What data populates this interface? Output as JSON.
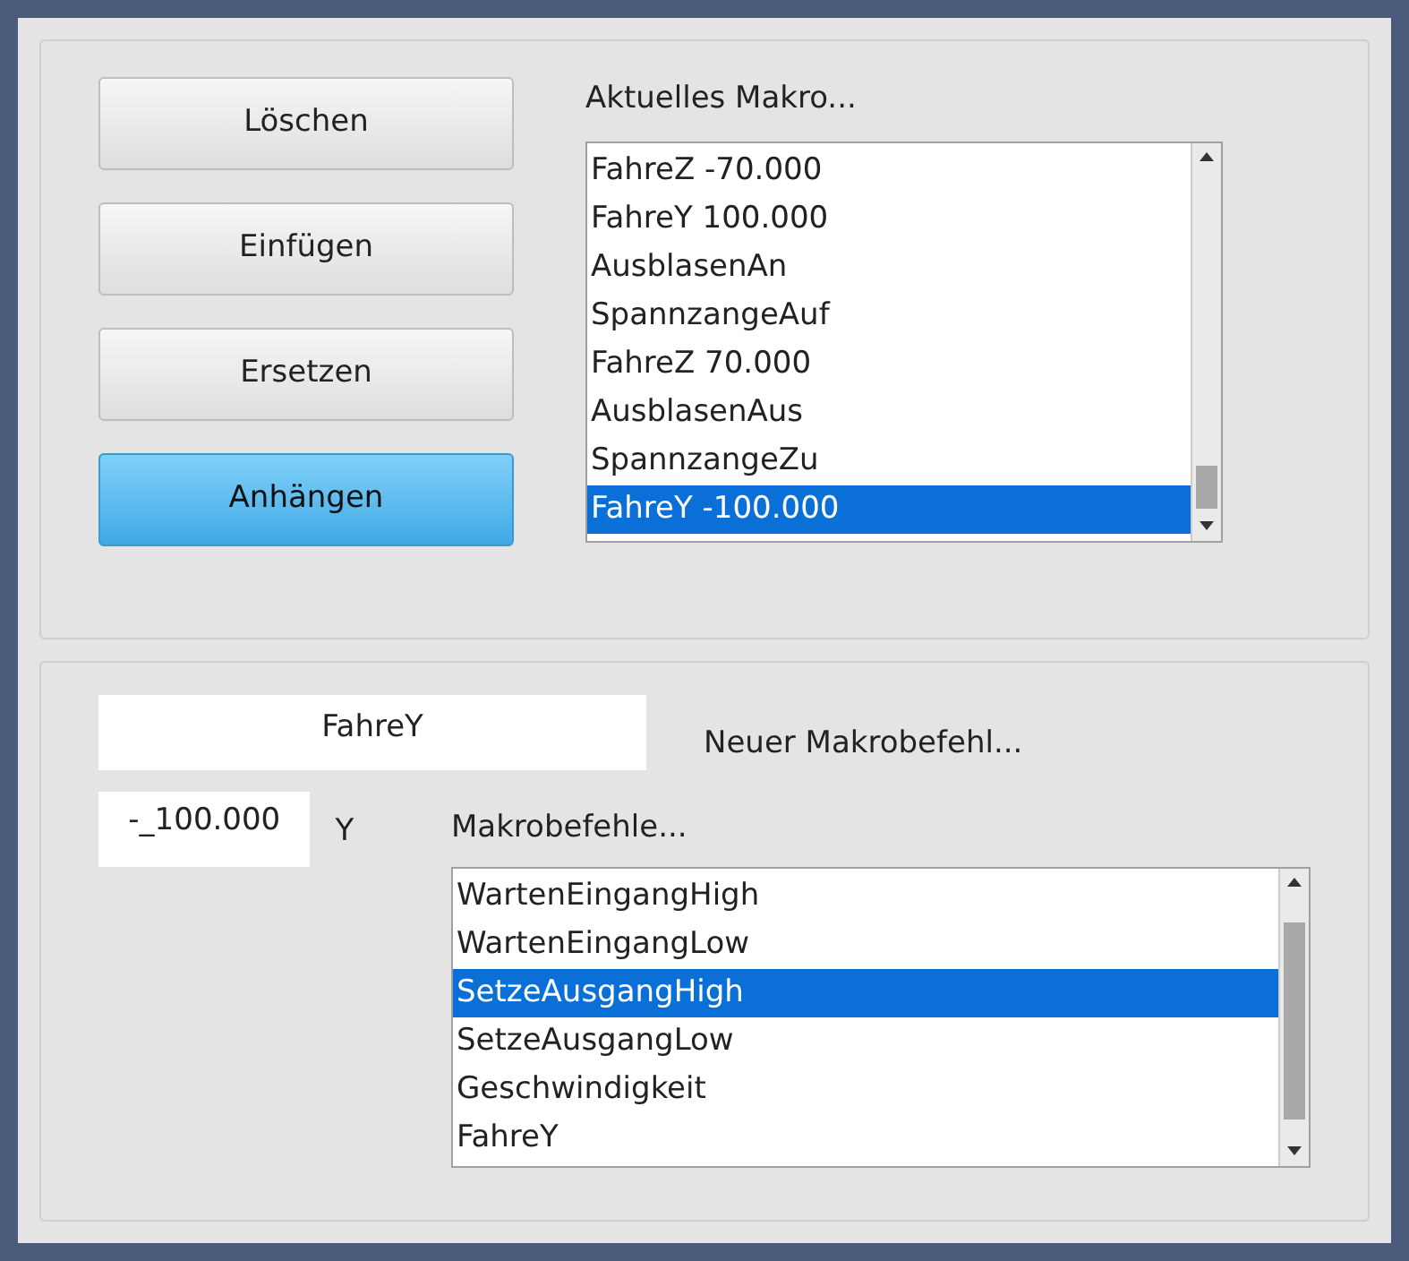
{
  "buttons": [
    {
      "label": "Löschen",
      "selected": false
    },
    {
      "label": "Einfügen",
      "selected": false
    },
    {
      "label": "Ersetzen",
      "selected": false
    },
    {
      "label": "Anhängen",
      "selected": true
    }
  ],
  "current_macro": {
    "label": "Aktuelles Makro...",
    "items": [
      {
        "text": "FahreZ -70.000",
        "selected": false
      },
      {
        "text": "FahreY 100.000",
        "selected": false
      },
      {
        "text": "AusblasenAn",
        "selected": false
      },
      {
        "text": "SpannzangeAuf",
        "selected": false
      },
      {
        "text": "FahreZ 70.000",
        "selected": false
      },
      {
        "text": "AusblasenAus",
        "selected": false
      },
      {
        "text": "SpannzangeZu",
        "selected": false
      },
      {
        "text": "FahreY -100.000",
        "selected": true
      }
    ]
  },
  "new_command": {
    "value": "FahreY",
    "label": "Neuer Makrobefehl..."
  },
  "parameter": {
    "value": "-_100.000",
    "unit": "Y"
  },
  "commands": {
    "label": "Makrobefehle...",
    "items": [
      {
        "text": "WartenEingangHigh",
        "selected": false
      },
      {
        "text": "WartenEingangLow",
        "selected": false
      },
      {
        "text": "SetzeAusgangHigh",
        "selected": true
      },
      {
        "text": "SetzeAusgangLow",
        "selected": false
      },
      {
        "text": "Geschwindigkeit",
        "selected": false
      },
      {
        "text": "FahreY",
        "selected": false
      }
    ]
  }
}
